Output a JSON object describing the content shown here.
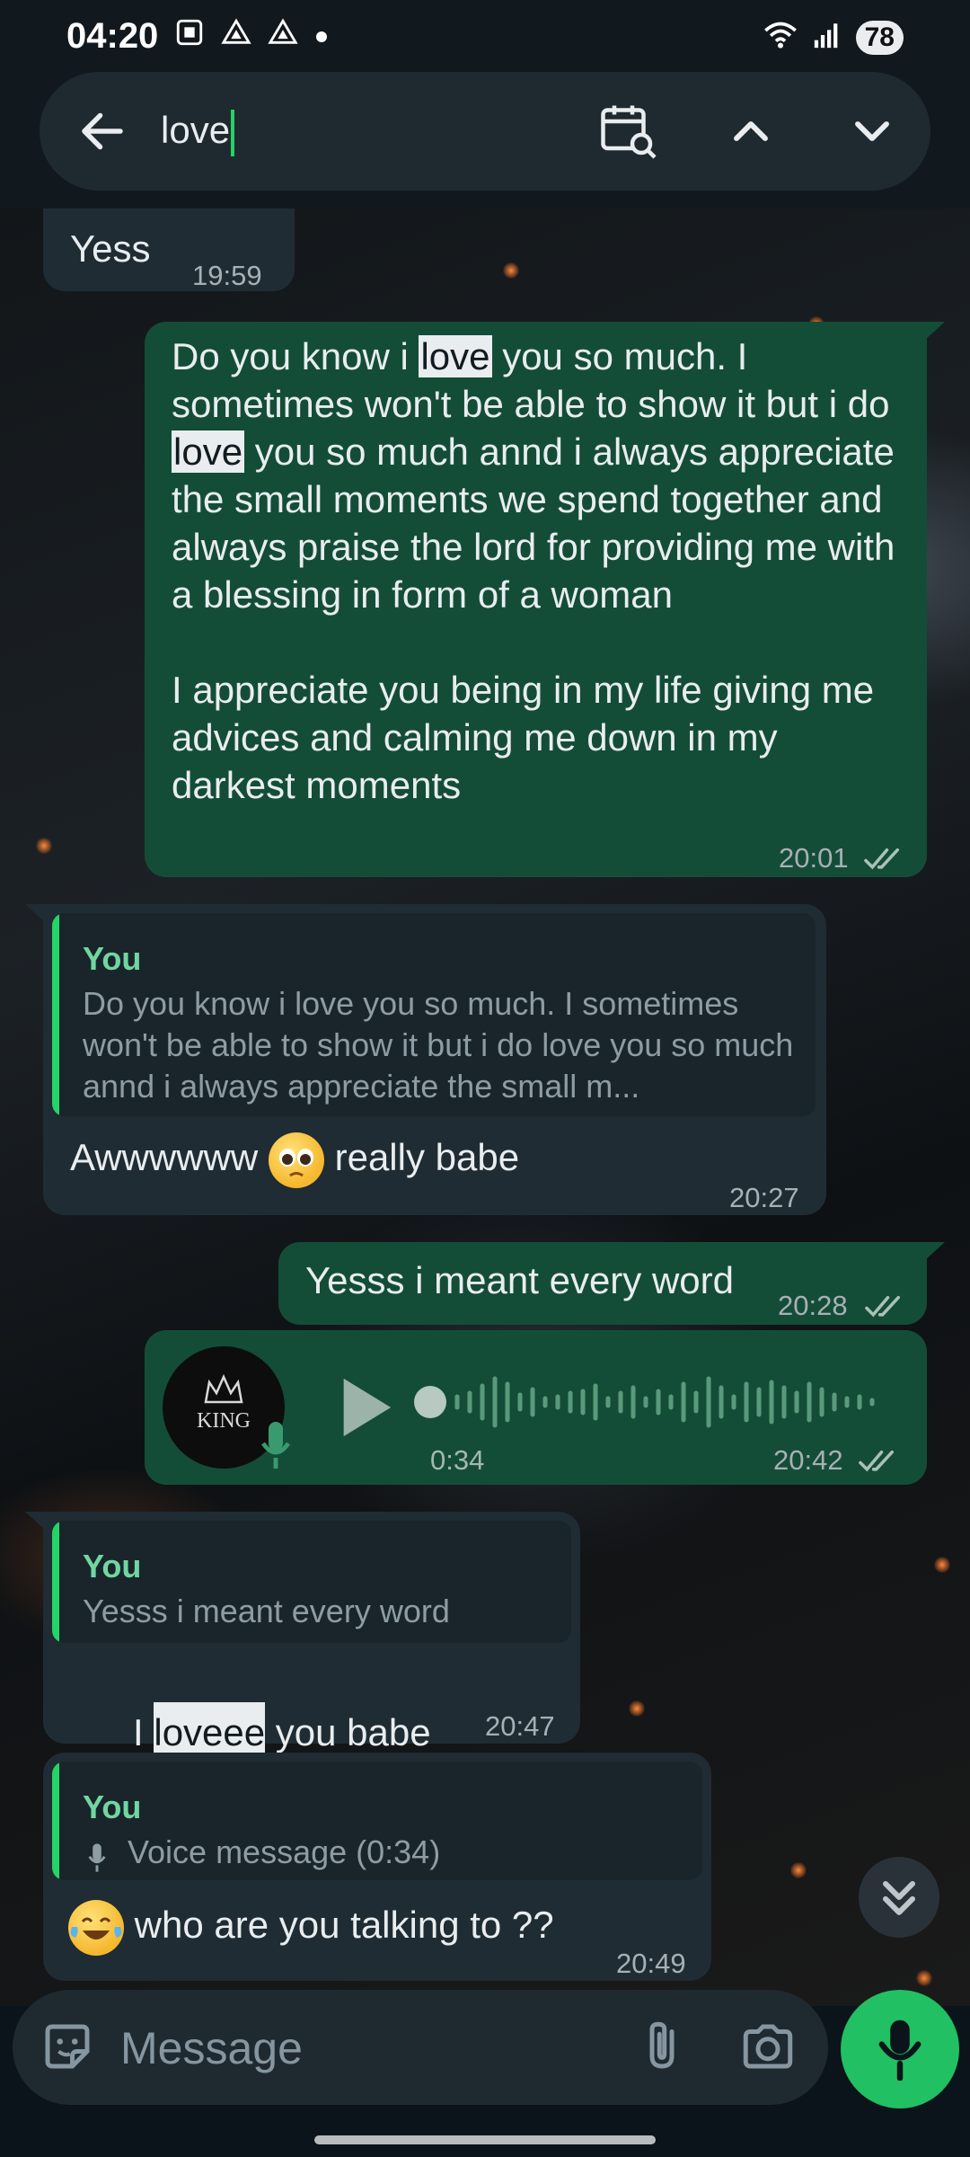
{
  "status_bar": {
    "time": "04:20",
    "battery": "78"
  },
  "search": {
    "query": "love"
  },
  "messages": {
    "m1": {
      "text": "Yess",
      "time": "19:59"
    },
    "m2": {
      "p1": "Do you know i ",
      "h1": "love",
      "p2": " you so much. I sometimes won't be able to show it but i do ",
      "h2": "love",
      "p3": " you so much annd i always appreciate the small moments we spend together and always praise the lord for providing me with a blessing in form of a woman",
      "p4": "I appreciate you being in my life giving me advices and calming me down in my darkest moments",
      "time": "20:01"
    },
    "m3": {
      "quote_name": "You",
      "quote_text": "Do you know i love you so much. I sometimes won't be able to show it but i do love you so much annd i always appreciate the small m...",
      "text_a": "Awwwwww",
      "text_b": "really babe",
      "time": "20:27"
    },
    "m4": {
      "text": "Yesss i meant every word",
      "time": "20:28"
    },
    "m5": {
      "avatar_text": "KING",
      "duration": "0:34",
      "time": "20:42"
    },
    "m6": {
      "quote_name": "You",
      "quote_text": "Yesss i meant every word",
      "text_a": "I ",
      "highlight": "loveee",
      "text_b": " you babe",
      "time": "20:47"
    },
    "m7": {
      "quote_name": "You",
      "quote_text": "Voice message (0:34)",
      "text": "who are you talking to ??",
      "time": "20:49"
    }
  },
  "composer": {
    "placeholder": "Message"
  },
  "colors": {
    "accent": "#25d366",
    "outgoing": "#144d37",
    "incoming": "#1f2c33"
  },
  "icons": [
    "arrow-back-icon",
    "calendar-search-icon",
    "chevron-up-icon",
    "chevron-down-icon",
    "sticker-icon",
    "paperclip-icon",
    "camera-icon",
    "mic-icon",
    "play-icon",
    "double-tick-icon"
  ]
}
